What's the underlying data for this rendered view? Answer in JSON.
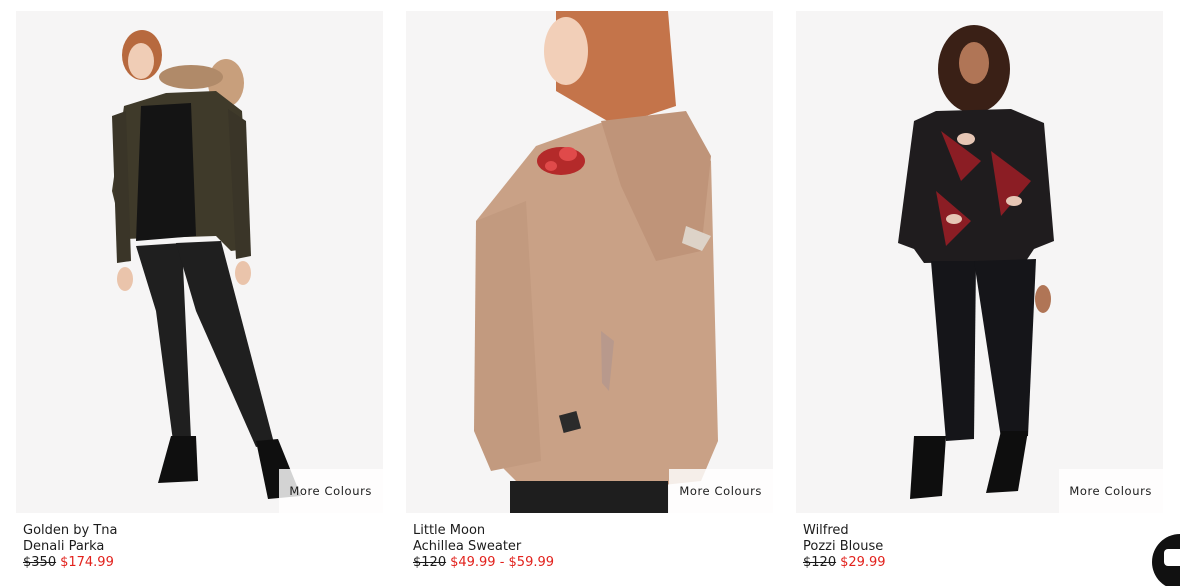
{
  "products": [
    {
      "brand": "Golden by Tna",
      "name": "Denali Parka",
      "price_original": "$350",
      "price_sale": "$174.99",
      "more_colours": "More Colours"
    },
    {
      "brand": "Little Moon",
      "name": "Achillea Sweater",
      "price_original": "$120",
      "price_sale": "$49.99 - $59.99",
      "more_colours": "More Colours"
    },
    {
      "brand": "Wilfred",
      "name": "Pozzi Blouse",
      "price_original": "$120",
      "price_sale": "$29.99",
      "more_colours": "More Colours"
    }
  ],
  "colors": {
    "sale_price": "#e2221d",
    "image_background": "#f6f5f5",
    "text": "#1c1c1c"
  },
  "chat_widget": {
    "icon": "chat-bubble-icon"
  }
}
